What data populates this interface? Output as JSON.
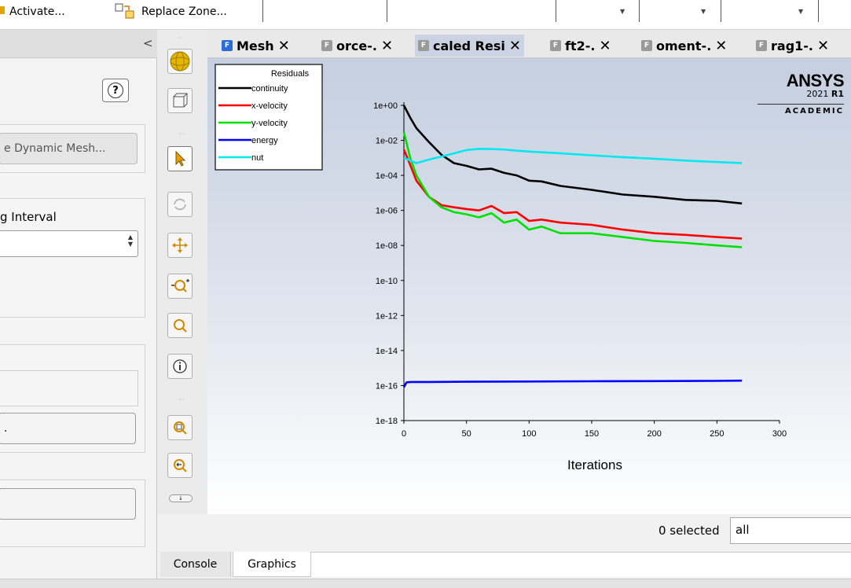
{
  "toolbar": {
    "activate_label": "Activate...",
    "replace_zone_label": "Replace Zone..."
  },
  "left_panel": {
    "help_label": "?",
    "dynamic_mesh_button": "e Dynamic Mesh...",
    "interval_label": "g Interval",
    "dots_button": ".",
    "collapse_label": "<"
  },
  "tabs": [
    {
      "label": "Mesh",
      "close": "✕"
    },
    {
      "label": "orce-.",
      "close": "✕"
    },
    {
      "label": "caled Resi",
      "close": "✕"
    },
    {
      "label": "ft2-.",
      "close": "✕"
    },
    {
      "label": "oment-.",
      "close": "✕"
    },
    {
      "label": "rag1-.",
      "close": "✕"
    }
  ],
  "logo": {
    "brand": "ANSYS",
    "version_prefix": "2021 ",
    "version_suffix": "R1",
    "edition": "ACADEMIC"
  },
  "chart_data": {
    "type": "line",
    "title": "",
    "xlabel": "Iterations",
    "ylabel": "",
    "yscale": "log",
    "xlim": [
      0,
      300
    ],
    "ylim": [
      1e-18,
      1
    ],
    "x_ticks": [
      "0",
      "50",
      "100",
      "150",
      "200",
      "250",
      "300"
    ],
    "y_ticks": [
      "1e+00",
      "1e-02",
      "1e-04",
      "1e-06",
      "1e-08",
      "1e-10",
      "1e-12",
      "1e-14",
      "1e-16",
      "1e-18"
    ],
    "legend": {
      "title": "Residuals",
      "position": "top-left"
    },
    "series": [
      {
        "name": "continuity",
        "color": "#000000",
        "x": [
          0,
          5,
          10,
          20,
          30,
          40,
          50,
          60,
          70,
          80,
          90,
          100,
          110,
          125,
          150,
          175,
          200,
          225,
          250,
          270
        ],
        "y": [
          1,
          0.2,
          0.05,
          0.008,
          0.0015,
          0.0005,
          0.00035,
          0.00022,
          0.00024,
          0.00014,
          0.0001,
          5e-05,
          4.5e-05,
          2.5e-05,
          1.5e-05,
          8e-06,
          6e-06,
          4e-06,
          3.5e-06,
          2.5e-06
        ]
      },
      {
        "name": "x-velocity",
        "color": "#ff0000",
        "x": [
          0,
          5,
          10,
          20,
          30,
          40,
          50,
          60,
          70,
          80,
          90,
          100,
          110,
          125,
          150,
          175,
          200,
          225,
          250,
          270
        ],
        "y": [
          0.003,
          0.0004,
          5e-05,
          6e-06,
          2e-06,
          1.5e-06,
          1.2e-06,
          1e-06,
          1.8e-06,
          7e-07,
          8e-07,
          2.5e-07,
          3e-07,
          2e-07,
          1.5e-07,
          8e-08,
          5e-08,
          4e-08,
          3e-08,
          2.5e-08
        ]
      },
      {
        "name": "y-velocity",
        "color": "#00e000",
        "x": [
          0,
          5,
          10,
          20,
          30,
          40,
          50,
          60,
          70,
          80,
          90,
          100,
          110,
          125,
          150,
          175,
          200,
          225,
          250,
          270
        ],
        "y": [
          0.03,
          0.001,
          0.0001,
          6e-06,
          1.5e-06,
          8e-07,
          6e-07,
          4e-07,
          7e-07,
          2e-07,
          3e-07,
          8e-08,
          1.2e-07,
          5e-08,
          5e-08,
          3e-08,
          1.8e-08,
          1.4e-08,
          1e-08,
          8e-09
        ]
      },
      {
        "name": "energy",
        "color": "#0000ff",
        "x": [
          0,
          2,
          5,
          20,
          50,
          100,
          150,
          200,
          250,
          270
        ],
        "y": [
          8e-17,
          1.5e-16,
          1.6e-16,
          1.6e-16,
          1.65e-16,
          1.7e-16,
          1.75e-16,
          1.8e-16,
          1.85e-16,
          1.9e-16
        ]
      },
      {
        "name": "nut",
        "color": "#00e8f0",
        "x": [
          0,
          10,
          20,
          30,
          40,
          50,
          60,
          70,
          80,
          90,
          100,
          120,
          150,
          175,
          200,
          225,
          250,
          270
        ],
        "y": [
          0.001,
          0.0005,
          0.0008,
          0.0012,
          0.0018,
          0.0028,
          0.0033,
          0.0032,
          0.003,
          0.0026,
          0.0023,
          0.0019,
          0.0014,
          0.0011,
          0.0009,
          0.0007,
          0.00058,
          0.0005
        ]
      }
    ]
  },
  "selection": {
    "count_label": "0 selected",
    "filter_value": "all"
  },
  "bottom_tabs": [
    "Console",
    "Graphics"
  ],
  "colors": {
    "active_tab": "#cbd3e2",
    "fluent_icon": "#2b6cd8"
  }
}
